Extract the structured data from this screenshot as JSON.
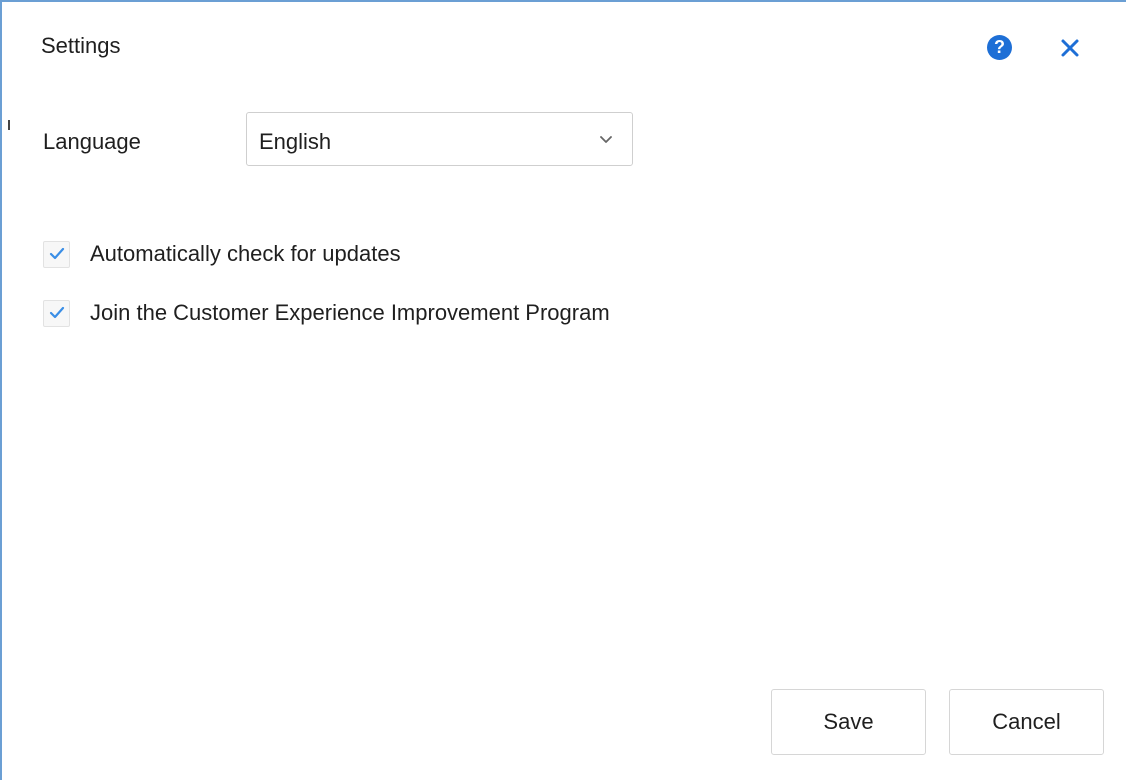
{
  "dialog": {
    "title": "Settings",
    "help_icon_glyph": "?",
    "icons": {
      "help": "question-circle-icon",
      "close": "close-icon",
      "dropdown": "chevron-down-icon",
      "check": "checkmark-icon"
    },
    "accent_color": "#1e6fd6"
  },
  "language": {
    "label": "Language",
    "selected": "English"
  },
  "options": [
    {
      "label": "Automatically check for updates",
      "checked": true
    },
    {
      "label": "Join the Customer Experience Improvement Program",
      "checked": true
    }
  ],
  "buttons": {
    "save": "Save",
    "cancel": "Cancel"
  }
}
